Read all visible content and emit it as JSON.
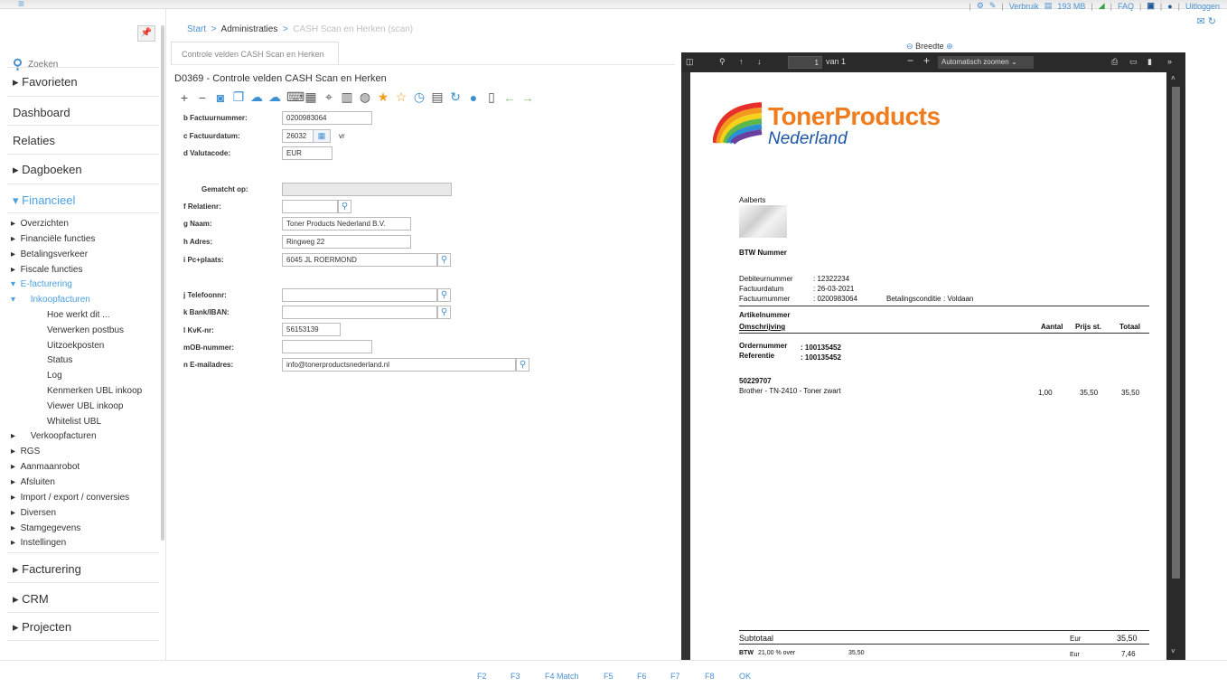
{
  "topbar": {
    "menu_icon": "hamburger-icon",
    "items": [
      "Verbruik",
      "193 MB",
      "FAQ",
      "Uitloggen"
    ]
  },
  "sidebar": {
    "search_placeholder": "Zoeken",
    "main": [
      "Favorieten",
      "Dashboard",
      "Relaties",
      "Dagboeken",
      "Financieel"
    ],
    "sub": [
      "Overzichten",
      "Financiële functies",
      "Betalingsverkeer",
      "Fiscale functies",
      "E-facturering",
      "Inkoopfacturen",
      "Hoe werkt dit ...",
      "Verwerken postbus",
      "Uitzoekposten",
      "Status",
      "Log",
      "Kenmerken UBL inkoop",
      "Viewer UBL inkoop",
      "Whitelist UBL",
      "Verkoopfacturen",
      "RGS",
      "Aanmaanrobot",
      "Afsluiten",
      "Import / export / conversies",
      "Diversen",
      "Stamgegevens",
      "Instellingen"
    ],
    "bottom": [
      "Facturering",
      "CRM",
      "Projecten"
    ]
  },
  "breadcrumb": [
    "Start",
    "Administraties",
    "CASH Scan en Herken (scan)"
  ],
  "tab_label": "Controle velden CASH Scan en Herken",
  "form": {
    "title": "D0369 - Controle velden CASH Scan en Herken",
    "labels": {
      "factuurnummer": "b Factuurnummer:",
      "factuurdatum": "c Factuurdatum:",
      "valutacode": "d Valutacode:",
      "gematcht": "Gematcht op:",
      "relatienr": "f Relatienr:",
      "naam": "g Naam:",
      "adres": "h Adres:",
      "pcplaats": "i Pc+plaats:",
      "telefoon": "j Telefoonnr:",
      "bank": "k Bank/IBAN:",
      "kvk": "l KvK-nr:",
      "mob": "mOB-nummer:",
      "email": "n E-mailadres:"
    },
    "values": {
      "factuurnummer": "0200983064",
      "factuurdatum": "26032",
      "factuurdatum_suffix": "vr",
      "valutacode": "EUR",
      "naam": "Toner Products Nederland B.V.",
      "adres": "Ringweg 22",
      "pcplaats": "6045 JL ROERMOND",
      "kvk": "56153139",
      "email": "info@tonerproductsnederland.nl"
    }
  },
  "pdf": {
    "breedte_label": "Breedte",
    "page_number": "1",
    "page_total": "van 1",
    "zoom": "Automatisch zoomen",
    "logo_line1": "TonerProducts",
    "logo_line2": "Nederland",
    "customer": "Aalberts",
    "btw_nummer": "BTW Nummer",
    "debiteur_label": "Debiteurnummer",
    "debiteur_value": ": 12322234",
    "datum_label": "Factuurdatum",
    "datum_value": ": 26-03-2021",
    "nummer_label": "Factuurnummer",
    "nummer_value": ": 0200983064",
    "conditie_label": "Betalingsconditie",
    "conditie_value": ": Voldaan",
    "col_artikel": "Artikelnummer",
    "col_omschrijving": "Omschrijving",
    "col_aantal": "Aantal",
    "col_prijs": "Prijs st.",
    "col_totaal": "Totaal",
    "order_label": "Ordernummer",
    "order_value": ": 100135452",
    "ref_label": "Referentie",
    "ref_value": ": 100135452",
    "item_code": "50229707",
    "item_desc": "Brother - TN-2410 - Toner zwart",
    "item_aantal": "1,00",
    "item_prijs": "35,50",
    "item_totaal": "35,50",
    "subtotaal_label": "Subtotaal",
    "subtotaal_cur": "Eur",
    "subtotaal_value": "35,50",
    "btw_label": "BTW",
    "btw_rate": "21,00 % over",
    "btw_base": "35,50",
    "btw_cur": "Eur",
    "btw_value": "7,46"
  },
  "fkeys": [
    "F2",
    "F3",
    "F4 Match",
    "F5",
    "F6",
    "F7",
    "F8",
    "OK"
  ]
}
